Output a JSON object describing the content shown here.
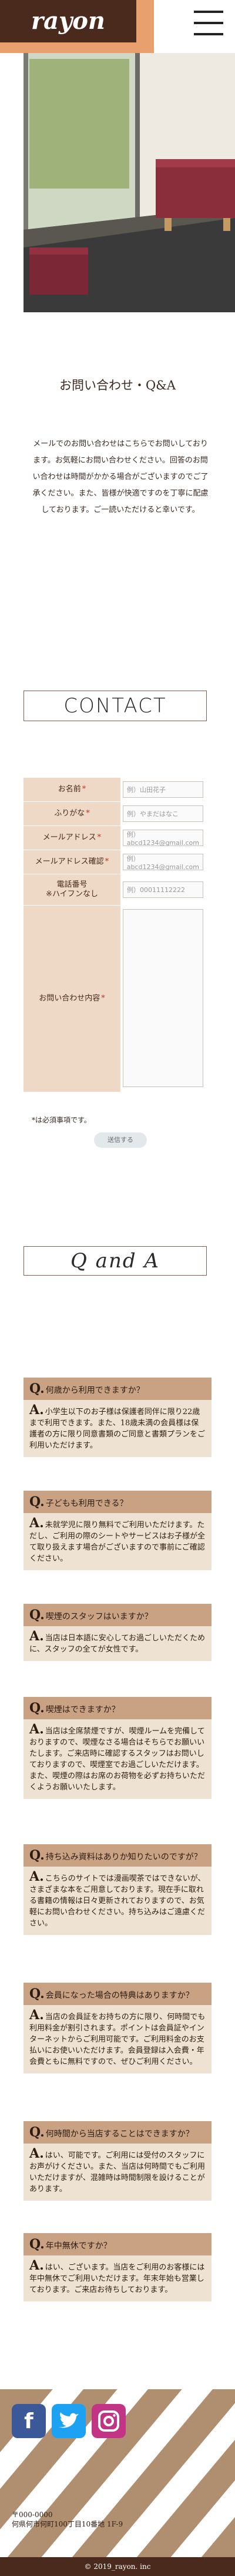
{
  "header": {
    "logo": "rayon",
    "menu_icon": "hamburger-menu-icon"
  },
  "page": {
    "title": "お問い合わせ・Q&A",
    "lead": "メールでのお問い合わせはこちらでお問いしております。お気軽にお問い合わせください。回答のお問い合わせは時間がかかる場合がございますのでご了承ください。また、皆様が快適ですのを丁寧に配慮しております。ご一読いただけると幸いです。"
  },
  "contact": {
    "heading": "CONTACT",
    "fields": [
      {
        "label": "お名前",
        "required": true,
        "placeholder": "例）山田花子"
      },
      {
        "label": "ふりがな",
        "required": true,
        "placeholder": "例）やまだはなこ"
      },
      {
        "label": "メールアドレス",
        "required": true,
        "placeholder": "例）abcd1234@gmail.com"
      },
      {
        "label": "メールアドレス確認",
        "required": true,
        "placeholder": "例）abcd1234@gmail.com"
      },
      {
        "label": "電話番号\n※ハイフンなし",
        "required": false,
        "placeholder": "例）00011112222"
      },
      {
        "label": "お問い合わせ内容",
        "required": true,
        "placeholder": ""
      }
    ],
    "required_mark": "*",
    "note": "*は必須事項です。",
    "send_label": "送信する"
  },
  "qa": {
    "heading": "Q and A",
    "items": [
      {
        "q": "何歳から利用できますか？",
        "a": "小学生以下のお子様は保護者同伴に限り22歳まで利用できます。また、18歳未満の会員様は保護者の方に限り同意書類のご同意と書類プランをご利用いただけます。"
      },
      {
        "q": "子どもも利用できる？",
        "a": "未就学児に限り無料でご利用いただけます。ただし、ご利用の際のシートやサービスはお子様が全て取り扱えます場合がございますので事前にご確認ください。"
      },
      {
        "q": "喫煙のスタッフはいますか？",
        "a": "当店は日本語に安心してお過ごしいただくために、スタッフの全てが女性です。"
      },
      {
        "q": "喫煙はできますか？",
        "a": "当店は全席禁煙ですが、喫煙ルームを完備しておりますので、喫煙なさる場合はそちらでお願いいたします。ご来店時に確認するスタッフはお問いしておりますので、喫煙室でお過ごしいただけます。また、喫煙の際はお席のお荷物を必ずお持ちいただくようお願いいたします。"
      },
      {
        "q": "持ち込み資料はありか知りたいのですが？",
        "a": "こちらのサイトでは漫画喫茶ではできないが、さまざまな本をご用意しております。現在手に取れる書籍の情報は日々更新されておりますので、お気軽にお問い合わせください。持ち込みはご遠慮ください。"
      },
      {
        "q": "会員になった場合の特典はありますか？",
        "a": "当店の会員証をお持ちの方に限り、何時間でも利用料金が割引されます。ポイントは会員証やインターネットからご利用可能です。ご利用料金のお支払いにお使いいただけます。会員登録は入会費・年会費ともに無料ですので、ぜひご利用ください。"
      },
      {
        "q": "何時間から当店することはできますか？",
        "a": "はい、可能です。ご利用には受付のスタッフにお声がけください。また、当店は何時間でもご利用いただけますが、混雑時は時間制限を設けることがあります。"
      },
      {
        "q": "年中無休ですか？",
        "a": "はい、ございます。当店をご利用のお客様には年中無休でご利用いただけます。年末年始も営業しております。ご来店お待ちしております。"
      }
    ]
  },
  "footer": {
    "social": [
      "facebook-icon",
      "twitter-icon",
      "instagram-icon"
    ],
    "address_lines": [
      "〒000-0000",
      "何県何市何町100丁目10番地 1F-9"
    ],
    "copyright": "© 2019_rayon. inc"
  },
  "colors": {
    "brown": "#4a2a1c",
    "tan": "#c8a283",
    "beige": "#eee2d2",
    "orange": "#e8a06f"
  }
}
